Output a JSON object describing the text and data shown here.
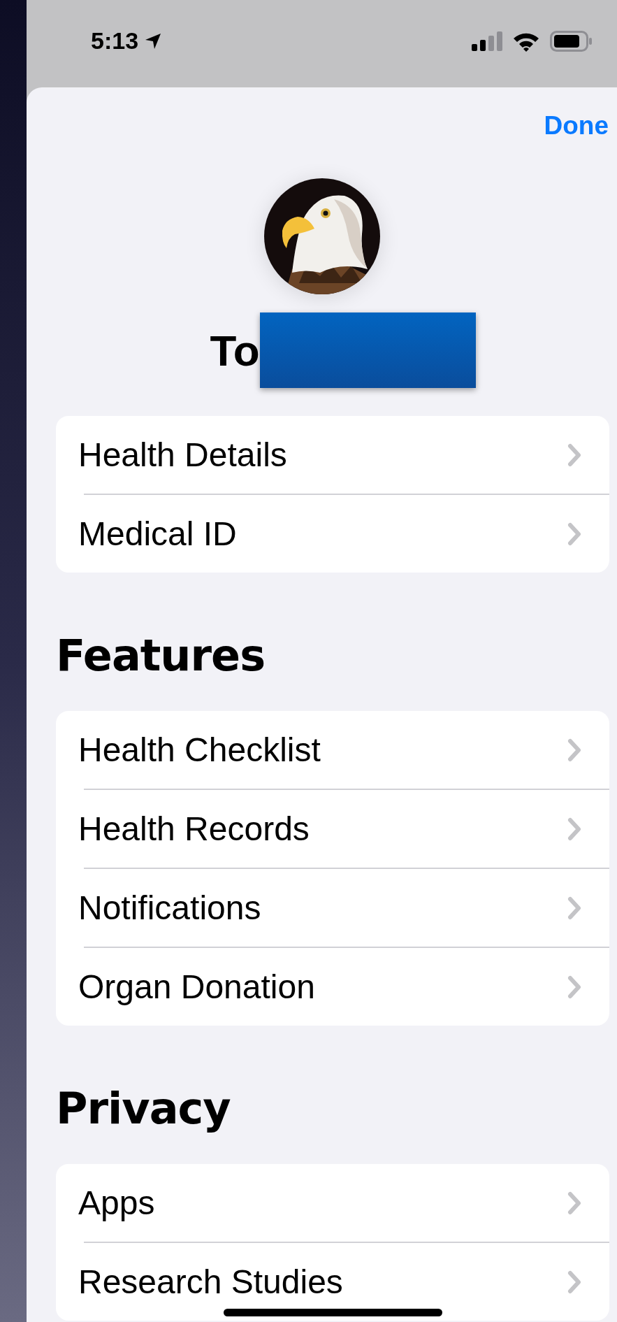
{
  "status_bar": {
    "time": "5:13"
  },
  "header": {
    "done": "Done"
  },
  "profile": {
    "name": "To"
  },
  "groups": [
    {
      "items": [
        {
          "label": "Health Details"
        },
        {
          "label": "Medical ID"
        }
      ]
    },
    {
      "title": "Features",
      "items": [
        {
          "label": "Health Checklist"
        },
        {
          "label": "Health Records"
        },
        {
          "label": "Notifications"
        },
        {
          "label": "Organ Donation"
        }
      ]
    },
    {
      "title": "Privacy",
      "items": [
        {
          "label": "Apps"
        },
        {
          "label": "Research Studies"
        }
      ]
    }
  ]
}
